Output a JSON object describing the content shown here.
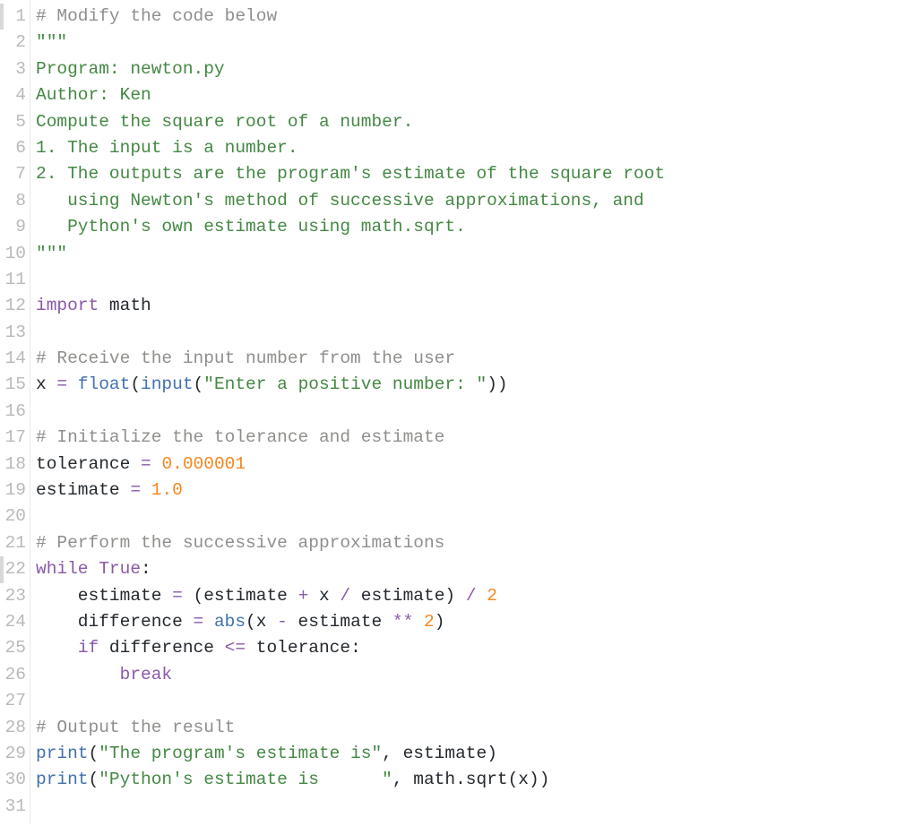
{
  "gutter": {
    "start": 1,
    "end": 31
  },
  "code": {
    "lines": [
      [
        {
          "cls": "tok-comment",
          "t": "# Modify the code below"
        }
      ],
      [
        {
          "cls": "tok-string",
          "t": "\"\"\""
        }
      ],
      [
        {
          "cls": "tok-string",
          "t": "Program: newton.py"
        }
      ],
      [
        {
          "cls": "tok-string",
          "t": "Author: Ken"
        }
      ],
      [
        {
          "cls": "tok-string",
          "t": "Compute the square root of a number."
        }
      ],
      [
        {
          "cls": "tok-string",
          "t": "1. The input is a number."
        }
      ],
      [
        {
          "cls": "tok-string",
          "t": "2. The outputs are the program's estimate of the square root"
        }
      ],
      [
        {
          "cls": "tok-string",
          "t": "   using Newton's method of successive approximations, and"
        }
      ],
      [
        {
          "cls": "tok-string",
          "t": "   Python's own estimate using math.sqrt."
        }
      ],
      [
        {
          "cls": "tok-string",
          "t": "\"\"\""
        }
      ],
      [
        {
          "cls": "",
          "t": ""
        }
      ],
      [
        {
          "cls": "tok-keyword",
          "t": "import"
        },
        {
          "cls": "",
          "t": " math"
        }
      ],
      [
        {
          "cls": "",
          "t": ""
        }
      ],
      [
        {
          "cls": "tok-comment",
          "t": "# Receive the input number from the user"
        }
      ],
      [
        {
          "cls": "",
          "t": "x "
        },
        {
          "cls": "tok-operator",
          "t": "="
        },
        {
          "cls": "",
          "t": " "
        },
        {
          "cls": "tok-builtin",
          "t": "float"
        },
        {
          "cls": "",
          "t": "("
        },
        {
          "cls": "tok-builtin",
          "t": "input"
        },
        {
          "cls": "",
          "t": "("
        },
        {
          "cls": "tok-string",
          "t": "\"Enter a positive number: \""
        },
        {
          "cls": "",
          "t": "))"
        }
      ],
      [
        {
          "cls": "",
          "t": ""
        }
      ],
      [
        {
          "cls": "tok-comment",
          "t": "# Initialize the tolerance and estimate"
        }
      ],
      [
        {
          "cls": "",
          "t": "tolerance "
        },
        {
          "cls": "tok-operator",
          "t": "="
        },
        {
          "cls": "",
          "t": " "
        },
        {
          "cls": "tok-number",
          "t": "0.000001"
        }
      ],
      [
        {
          "cls": "",
          "t": "estimate "
        },
        {
          "cls": "tok-operator",
          "t": "="
        },
        {
          "cls": "",
          "t": " "
        },
        {
          "cls": "tok-number",
          "t": "1.0"
        }
      ],
      [
        {
          "cls": "",
          "t": ""
        }
      ],
      [
        {
          "cls": "tok-comment",
          "t": "# Perform the successive approximations"
        }
      ],
      [
        {
          "cls": "tok-keyword",
          "t": "while"
        },
        {
          "cls": "",
          "t": " "
        },
        {
          "cls": "tok-keyword",
          "t": "True"
        },
        {
          "cls": "",
          "t": ":"
        }
      ],
      [
        {
          "cls": "",
          "t": "    estimate "
        },
        {
          "cls": "tok-operator",
          "t": "="
        },
        {
          "cls": "",
          "t": " (estimate "
        },
        {
          "cls": "tok-operator",
          "t": "+"
        },
        {
          "cls": "",
          "t": " x "
        },
        {
          "cls": "tok-operator",
          "t": "/"
        },
        {
          "cls": "",
          "t": " estimate) "
        },
        {
          "cls": "tok-operator",
          "t": "/"
        },
        {
          "cls": "",
          "t": " "
        },
        {
          "cls": "tok-number",
          "t": "2"
        }
      ],
      [
        {
          "cls": "",
          "t": "    difference "
        },
        {
          "cls": "tok-operator",
          "t": "="
        },
        {
          "cls": "",
          "t": " "
        },
        {
          "cls": "tok-builtin",
          "t": "abs"
        },
        {
          "cls": "",
          "t": "(x "
        },
        {
          "cls": "tok-operator",
          "t": "-"
        },
        {
          "cls": "",
          "t": " estimate "
        },
        {
          "cls": "tok-operator",
          "t": "**"
        },
        {
          "cls": "",
          "t": " "
        },
        {
          "cls": "tok-number",
          "t": "2"
        },
        {
          "cls": "",
          "t": ")"
        }
      ],
      [
        {
          "cls": "",
          "t": "    "
        },
        {
          "cls": "tok-keyword",
          "t": "if"
        },
        {
          "cls": "",
          "t": " difference "
        },
        {
          "cls": "tok-operator",
          "t": "<="
        },
        {
          "cls": "",
          "t": " tolerance:"
        }
      ],
      [
        {
          "cls": "",
          "t": "        "
        },
        {
          "cls": "tok-keyword",
          "t": "break"
        }
      ],
      [
        {
          "cls": "",
          "t": ""
        }
      ],
      [
        {
          "cls": "tok-comment",
          "t": "# Output the result"
        }
      ],
      [
        {
          "cls": "tok-builtin",
          "t": "print"
        },
        {
          "cls": "",
          "t": "("
        },
        {
          "cls": "tok-string",
          "t": "\"The program's estimate is\""
        },
        {
          "cls": "",
          "t": ", estimate)"
        }
      ],
      [
        {
          "cls": "tok-builtin",
          "t": "print"
        },
        {
          "cls": "",
          "t": "("
        },
        {
          "cls": "tok-string",
          "t": "\"Python's estimate is      \""
        },
        {
          "cls": "",
          "t": ", math.sqrt(x))"
        }
      ],
      [
        {
          "cls": "",
          "t": ""
        }
      ]
    ]
  }
}
